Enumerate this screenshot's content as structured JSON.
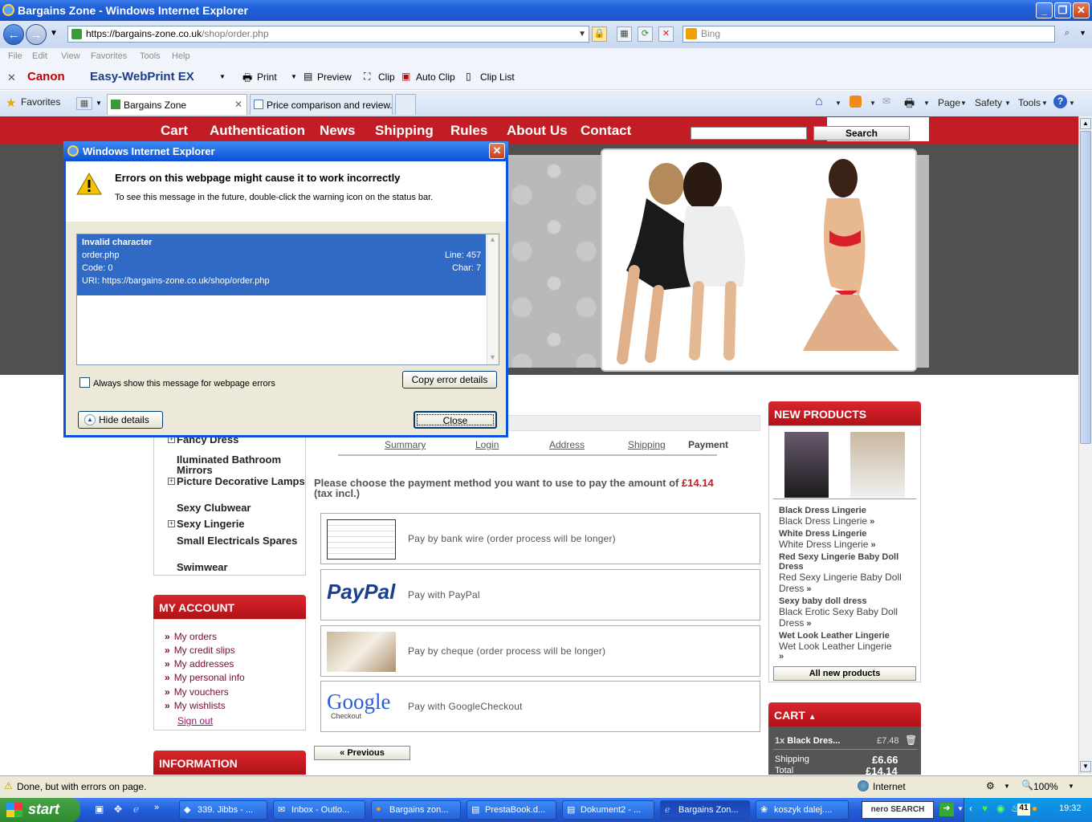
{
  "window": {
    "title": "Bargains Zone - Windows Internet Explorer"
  },
  "address": {
    "url_host": "https://bargains-zone.co.uk",
    "url_path": "/shop/order.php",
    "search_placeholder": "Bing"
  },
  "menu": [
    "File",
    "Edit",
    "View",
    "Favorites",
    "Tools",
    "Help"
  ],
  "canon": {
    "brand": "Canon",
    "product": "Easy-WebPrint EX",
    "print": "Print",
    "preview": "Preview",
    "clip": "Clip",
    "auto_clip": "Auto Clip",
    "clip_list": "Clip List"
  },
  "favbar": {
    "favorites": "Favorites",
    "tabs": [
      "Bargains Zone",
      "Price comparison and review..."
    ],
    "page": "Page",
    "safety": "Safety",
    "tools": "Tools"
  },
  "site": {
    "nav": [
      "Cart",
      "Authentication",
      "News",
      "Shipping",
      "Rules",
      "About Us",
      "Contact"
    ],
    "search_button": "Search",
    "categories": [
      "Fancy Dress",
      "Iluminated Bathroom Mirrors",
      "Picture Decorative Lamps",
      "Sexy Clubwear",
      "Sexy Lingerie",
      "Small Electricals Spares",
      "Swimwear"
    ],
    "my_account": {
      "title": "MY ACCOUNT",
      "links": [
        "My orders",
        "My credit slips",
        "My addresses",
        "My personal info",
        "My vouchers",
        "My wishlists"
      ],
      "sign_out": "Sign out"
    },
    "information_title": "INFORMATION",
    "steps": [
      "Summary",
      "Login",
      "Address",
      "Shipping",
      "Payment"
    ],
    "payment_prompt": "Please choose the payment method you want to use to pay the amount of",
    "amount": "£14.14",
    "tax_note": "(tax incl.)",
    "payments": [
      "Pay by bank wire (order process will be longer)",
      "Pay with PayPal",
      "Pay by cheque (order process will be longer)",
      "Pay with GoogleCheckout"
    ],
    "paypal_logo": "PayPal",
    "google_logo": "Google",
    "google_sub": "Checkout",
    "previous": "« Previous",
    "new_products": {
      "title": "NEW PRODUCTS",
      "items": [
        {
          "name": "Black Dress Lingerie",
          "desc": "Black Dress Lingerie"
        },
        {
          "name": "White Dress Lingerie",
          "desc": "White Dress Lingerie"
        },
        {
          "name": "Red Sexy Lingerie Baby Doll Dress",
          "desc": "Red Sexy Lingerie Baby Doll Dress"
        },
        {
          "name": "Sexy baby doll dress",
          "desc": "Black Erotic Sexy Baby Doll Dress"
        },
        {
          "name": "Wet Look Leather Lingerie",
          "desc": "Wet Look Leather Lingerie"
        }
      ],
      "all_button": "All new products"
    },
    "cart": {
      "title": "CART",
      "item_qty": "1x",
      "item_name": "Black Dres...",
      "item_price": "£7.48",
      "shipping_label": "Shipping",
      "shipping": "£6.66",
      "total_label": "Total",
      "total": "£14.14"
    }
  },
  "dialog": {
    "title": "Windows Internet Explorer",
    "heading": "Errors on this webpage might cause it to work incorrectly",
    "sub": "To see this message in the future, double-click the warning icon on the status bar.",
    "error_title": "Invalid character",
    "error_file": "order.php",
    "error_line": "Line: 457",
    "error_code": "Code: 0",
    "error_char": "Char: 7",
    "error_uri": "URI: https://bargains-zone.co.uk/shop/order.php",
    "always_show": "Always show this message for webpage errors",
    "copy_button": "Copy error details",
    "hide_button": "Hide details",
    "close_button": "Close"
  },
  "status": {
    "text": "Done, but with errors on page.",
    "zone": "Internet",
    "zoom": "100%"
  },
  "taskbar": {
    "start": "start",
    "tasks": [
      "339. Jibbs - ...",
      "Inbox - Outlo...",
      "Bargains zon...",
      "PrestaBook.d...",
      "Dokument2 - ...",
      "Bargains Zon...",
      "koszyk dalej...."
    ],
    "nero": "nero SEARCH",
    "tray_num": "41",
    "clock": "19:32"
  },
  "colors": {
    "accent_red": "#c21d24",
    "xp_blue": "#245edb",
    "selection": "#316ac5",
    "price_red": "#c21d24"
  }
}
